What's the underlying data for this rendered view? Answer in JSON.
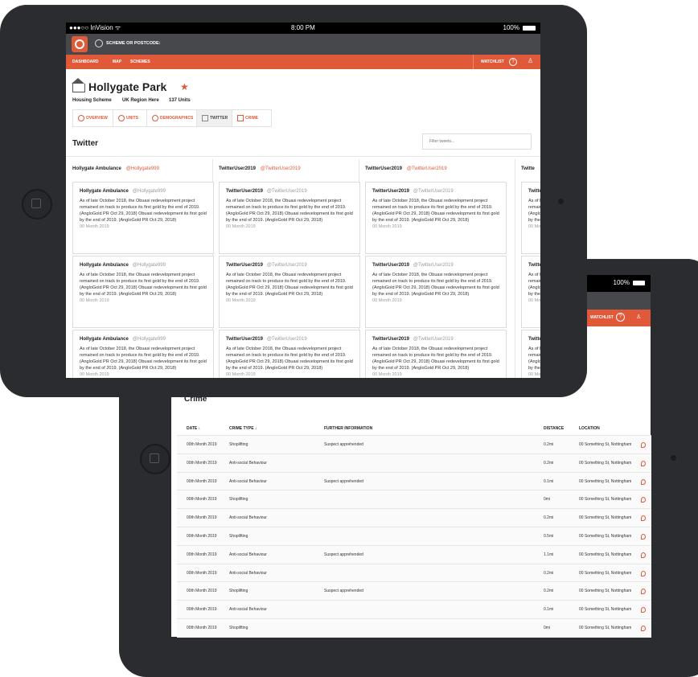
{
  "status": {
    "carrier": "●●●○○ InVision ᯤ",
    "time": "8:00 PM",
    "battery": "100%"
  },
  "search": {
    "placeholder": "SCHEME OR POSTCODE:"
  },
  "nav": {
    "items": [
      "DASHBOARD",
      "MAP",
      "SCHEMES"
    ],
    "watchlist": "WATCHLIST"
  },
  "property": {
    "name": "Hollygate Park",
    "star": "★",
    "type": "Housing Scheme",
    "region": "UK Region Here",
    "units": "137 Units"
  },
  "tabs": [
    "OVERVIEW",
    "UNITS",
    "DEMOGRAPHICS",
    "TWITTER",
    "CRIME"
  ],
  "twitter": {
    "title": "Twitter",
    "filter_placeholder": "Filter tweets...",
    "columns": [
      {
        "name": "Hollygate Ambulance",
        "handle": "@Hollygate999"
      },
      {
        "name": "TwitterUser2019",
        "handle": "@TwitterUser2019"
      },
      {
        "name": "TwitterUser2019",
        "handle": "@TwitterUser2019"
      },
      {
        "name": "Twitte",
        "handle": ""
      }
    ],
    "tweet_text": "As of late October 2018, the Obuasi redevelopment project remained on track to produce its first gold by the end of 2019. (AngloGold PR Oct 29, 2018) Obuasi redevelopment its first gold by the end of 2019. (AngloGold PR Oct 29, 2018)",
    "tweet_date": "00 Month 2019"
  },
  "crime": {
    "title": "Crime",
    "headers": [
      "DATE ↓",
      "CRIME TYPE ↓",
      "FURTHER INFORMATION",
      "DISTANCE",
      "LOCATION"
    ],
    "rows": [
      [
        "00th Month 2019",
        "Shoplifting",
        "Suspect apprehended",
        "0.2mi",
        "00 Something St, Nottingham"
      ],
      [
        "00th Month 2019",
        "Anti-social Behaviour",
        "",
        "0.2mi",
        "00 Something St, Nottingham"
      ],
      [
        "00th Month 2019",
        "Anti-social Behaviour",
        "Suspect apprehended",
        "0.1mi",
        "00 Something St, Nottingham"
      ],
      [
        "00th Month 2019",
        "Shoplifting",
        "",
        "0mi",
        "00 Something St, Nottingham"
      ],
      [
        "00th Month 2019",
        "Anti-social Behaviour",
        "",
        "0.2mi",
        "00 Something St, Nottingham"
      ],
      [
        "00th Month 2019",
        "Shoplifting",
        "",
        "0.5mi",
        "00 Something St, Nottingham"
      ],
      [
        "00th Month 2019",
        "Anti-social Behaviour",
        "Suspect apprehended",
        "1.1mi",
        "00 Something St, Nottingham"
      ],
      [
        "00th Month 2019",
        "Anti-social Behaviour",
        "",
        "0.2mi",
        "00 Something St, Nottingham"
      ],
      [
        "00th Month 2019",
        "Shoplifting",
        "Suspect apprehended",
        "0.2mi",
        "00 Something St, Nottingham"
      ],
      [
        "00th Month 2019",
        "Anti-social Behaviour",
        "",
        "0.1mi",
        "00 Something St, Nottingham"
      ],
      [
        "00th Month 2019",
        "Shoplifting",
        "",
        "0mi",
        "00 Something St, Nottingham"
      ]
    ]
  },
  "front_status": {
    "battery": "100%"
  },
  "front_nav": {
    "watchlist": "WATCHLIST"
  },
  "colors": {
    "accent": "#e05a3a",
    "topbar": "#47484c",
    "device": "#2b2c30"
  }
}
